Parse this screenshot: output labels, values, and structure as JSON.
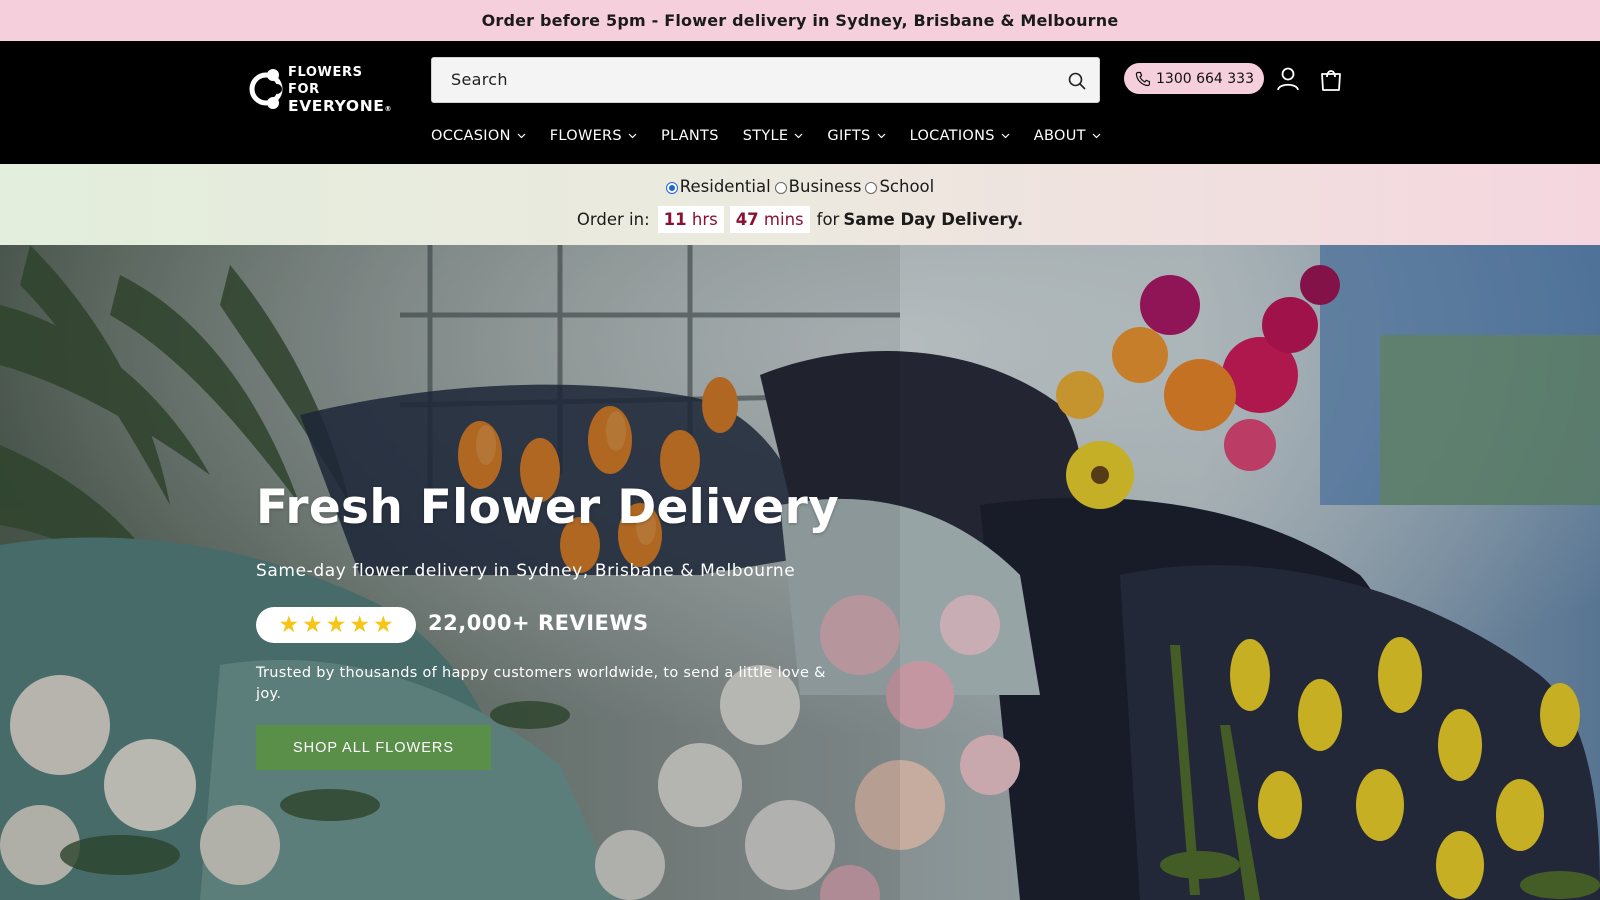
{
  "announcement": "Order before 5pm - Flower delivery in Sydney, Brisbane & Melbourne",
  "logo": {
    "line1": "FLOWERS",
    "line2": "FOR",
    "line3": "EVERYONE",
    "reg": "®"
  },
  "search": {
    "placeholder": "Search"
  },
  "phone": "1300 664 333",
  "nav": [
    {
      "label": "OCCASION",
      "dropdown": true
    },
    {
      "label": "FLOWERS",
      "dropdown": true
    },
    {
      "label": "PLANTS",
      "dropdown": false
    },
    {
      "label": "STYLE",
      "dropdown": true
    },
    {
      "label": "GIFTS",
      "dropdown": true
    },
    {
      "label": "LOCATIONS",
      "dropdown": true
    },
    {
      "label": "ABOUT",
      "dropdown": true
    }
  ],
  "delivery_type": {
    "options": [
      "Residential",
      "Business",
      "School"
    ],
    "selected": "Residential"
  },
  "countdown": {
    "prefix": "Order in:",
    "hours": "11",
    "hours_unit": "hrs",
    "minutes": "47",
    "minutes_unit": "mins",
    "for_text": "for",
    "suffix": "Same Day Delivery."
  },
  "hero": {
    "title": "Fresh Flower Delivery",
    "subtitle": "Same-day flower delivery in Sydney, Brisbane & Melbourne",
    "rating_stars": 5,
    "reviews": "22,000+ REVIEWS",
    "trusted": "Trusted by thousands of happy customers worldwide, to send a little love & joy.",
    "cta": "SHOP ALL FLOWERS"
  },
  "colors": {
    "announcement_bg": "#f5cfdc",
    "header_bg": "#000000",
    "phone_pill": "#f5cfdc",
    "cta_bg": "#5a8f4a",
    "star": "#f5c518",
    "countdown_text": "#8a1133"
  },
  "icons": [
    "search-icon",
    "phone-icon",
    "account-icon",
    "cart-icon",
    "chevron-down-icon",
    "star-icon"
  ]
}
